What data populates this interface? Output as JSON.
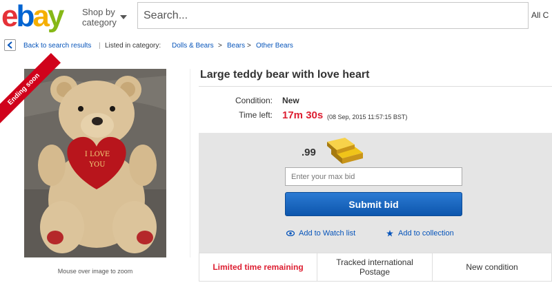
{
  "logo": {
    "e": "e",
    "b": "b",
    "a": "a",
    "y": "y"
  },
  "header": {
    "shop_by_line1": "Shop by",
    "shop_by_line2": "category",
    "search_placeholder": "Search...",
    "category_select": "All C"
  },
  "breadcrumb": {
    "back_label": "Back to search results",
    "separator": "|",
    "listed_in": "Listed in category:",
    "items": [
      "Dolls & Bears",
      "Bears",
      "Other Bears"
    ],
    "arrow": ">"
  },
  "image": {
    "ribbon": "Ending soon",
    "heart_text_1": "I LOVE",
    "heart_text_2": "YOU",
    "zoom_note": "Mouse over image to zoom"
  },
  "item": {
    "title": "Large teddy bear with love heart",
    "condition_label": "Condition:",
    "condition_value": "New",
    "time_left_label": "Time left:",
    "time_left_value": "17m 30s",
    "end_date": "(08 Sep, 2015   11:57:15 BST)"
  },
  "bid": {
    "price": ".99",
    "max_bid_placeholder": "Enter your max bid",
    "submit_label": "Submit bid",
    "watch_label": "Add to Watch list",
    "collection_label": "Add to collection"
  },
  "strip": {
    "cell1": "Limited time remaining",
    "cell2_line1": "Tracked international",
    "cell2_line2": "Postage",
    "cell3": "New condition"
  },
  "colors": {
    "ebay_red": "#e53238",
    "ebay_blue": "#0064d2",
    "ebay_yellow": "#f5af02",
    "ebay_green": "#86b817",
    "link": "#0654ba",
    "urgent": "#dd1e31",
    "button": "#0d56ad"
  }
}
